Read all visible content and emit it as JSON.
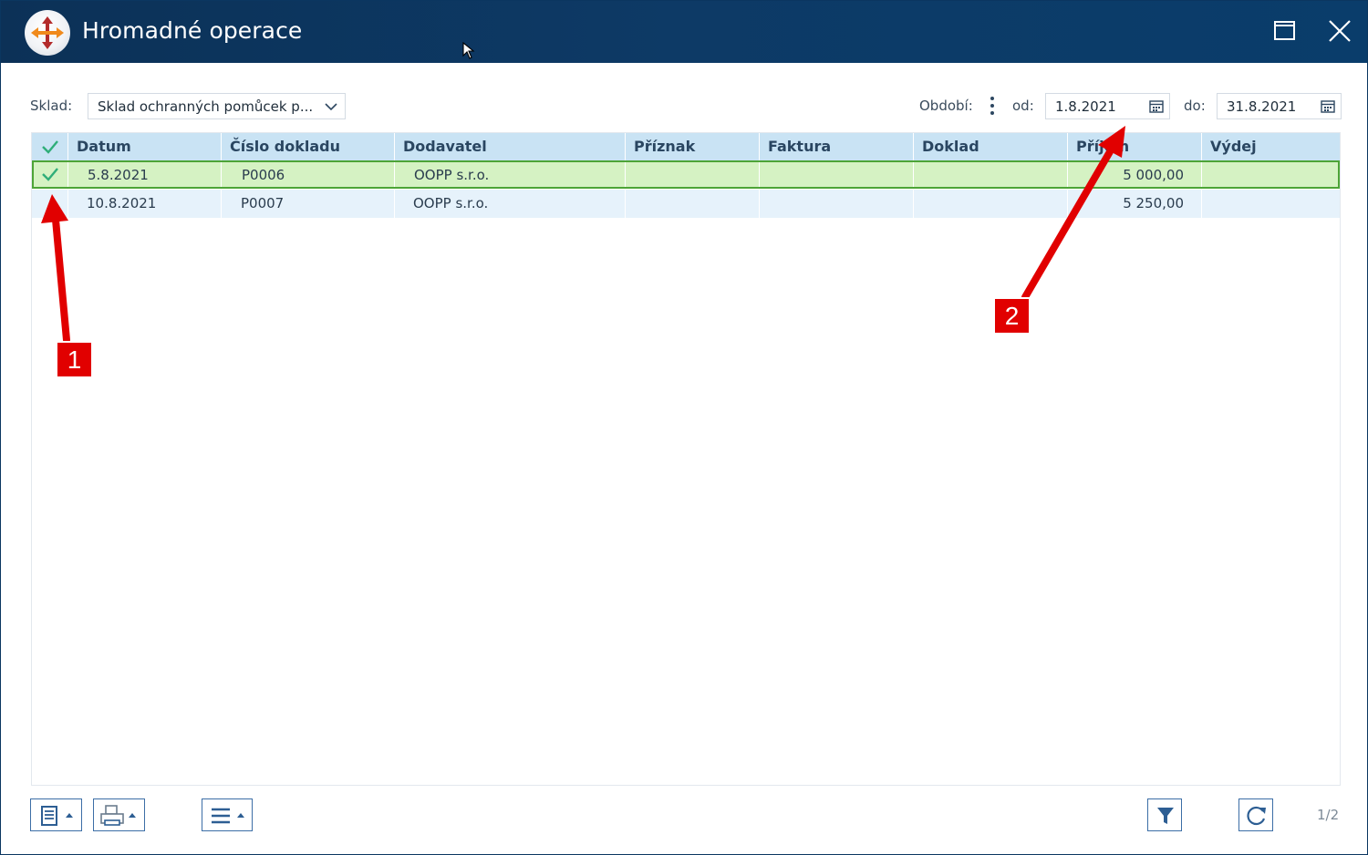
{
  "window": {
    "title": "Hromadné operace",
    "icons": {
      "logo": "app-logo-icon",
      "maximize": "maximize-icon",
      "close": "close-icon"
    }
  },
  "filters": {
    "sklad_label": "Sklad:",
    "sklad_value": "Sklad ochranných pomůcek p...",
    "obdobi_label": "Období:",
    "od_label": "od:",
    "od_value": "1.8.2021",
    "do_label": "do:",
    "do_value": "31.8.2021"
  },
  "grid": {
    "columns": [
      "Datum",
      "Číslo dokladu",
      "Dodavatel",
      "Příznak",
      "Faktura",
      "Doklad",
      "Příjem",
      "Výdej"
    ],
    "rows": [
      {
        "selected": true,
        "datum": "5.8.2021",
        "cislo": "P0006",
        "dodavatel": "OOPP s.r.o.",
        "priznak": "",
        "faktura": "",
        "doklad": "",
        "prijem": "5 000,00",
        "vydej": ""
      },
      {
        "selected": false,
        "datum": "10.8.2021",
        "cislo": "P0007",
        "dodavatel": "OOPP s.r.o.",
        "priznak": "",
        "faktura": "",
        "doklad": "",
        "prijem": "5 250,00",
        "vydej": ""
      }
    ]
  },
  "annotations": {
    "badge1": "1",
    "badge2": "2",
    "color": "#e10000"
  },
  "footer": {
    "pager": "1/2"
  },
  "colors": {
    "titlebar": "#0c3157",
    "header": "#c9e3f4",
    "selected_row": "#d5f2c3",
    "selected_border": "#4da437",
    "alt_row": "#e6f2fb",
    "check": "#2fae79"
  }
}
